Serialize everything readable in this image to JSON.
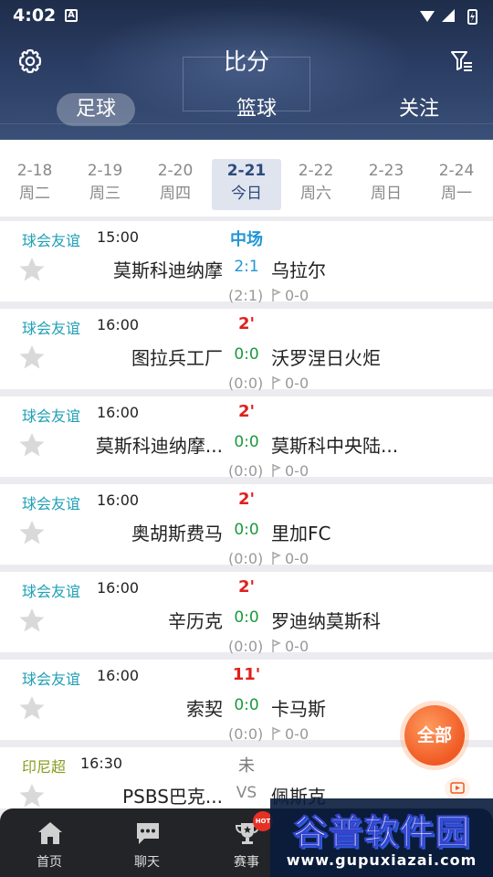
{
  "status_bar": {
    "time": "4:02",
    "notification_letter": "A"
  },
  "header": {
    "title": "比分"
  },
  "tabs": [
    {
      "label": "足球",
      "active": true
    },
    {
      "label": "篮球",
      "active": false
    },
    {
      "label": "关注",
      "active": false
    }
  ],
  "dates": [
    {
      "date": "2-18",
      "weekday": "周二"
    },
    {
      "date": "2-19",
      "weekday": "周三"
    },
    {
      "date": "2-20",
      "weekday": "周四"
    },
    {
      "date": "2-21",
      "weekday": "今日",
      "active": true
    },
    {
      "date": "2-22",
      "weekday": "周六"
    },
    {
      "date": "2-23",
      "weekday": "周日"
    },
    {
      "date": "2-24",
      "weekday": "周一"
    }
  ],
  "matches": [
    {
      "league": "球会友谊",
      "time": "15:00",
      "home": "莫斯科迪纳摩",
      "away": "乌拉尔",
      "status": "中场",
      "score": "2:1",
      "half": "(2:1)",
      "corners": "0-0"
    },
    {
      "league": "球会友谊",
      "time": "16:00",
      "home": "图拉兵工厂",
      "away": "沃罗涅日火炬",
      "status": "2'",
      "score": "0:0",
      "half": "(0:0)",
      "corners": "0-0"
    },
    {
      "league": "球会友谊",
      "time": "16:00",
      "home": "莫斯科迪纳摩...",
      "away": "莫斯科中央陆...",
      "status": "2'",
      "score": "0:0",
      "half": "(0:0)",
      "corners": "0-0"
    },
    {
      "league": "球会友谊",
      "time": "16:00",
      "home": "奥胡斯费马",
      "away": "里加FC",
      "status": "2'",
      "score": "0:0",
      "half": "(0:0)",
      "corners": "0-0"
    },
    {
      "league": "球会友谊",
      "time": "16:00",
      "home": "辛历克",
      "away": "罗迪纳莫斯科",
      "status": "2'",
      "score": "0:0",
      "half": "(0:0)",
      "corners": "0-0"
    },
    {
      "league": "球会友谊",
      "time": "16:00",
      "home": "索契",
      "away": "卡马斯",
      "status": "11'",
      "score": "0:0",
      "half": "(0:0)",
      "corners": "0-0"
    },
    {
      "league": "印尼超",
      "time": "16:30",
      "home": "PSBS巴克...",
      "away": "佩斯克",
      "status": "未",
      "score": "VS"
    }
  ],
  "fab": {
    "label": "全部"
  },
  "bottom_nav": [
    {
      "label": "首页",
      "icon": "home-icon"
    },
    {
      "label": "聊天",
      "icon": "chat-icon"
    },
    {
      "label": "赛事",
      "icon": "trophy-icon"
    }
  ],
  "hot_badge": "HOT",
  "watermark": {
    "logo": "谷普软件园",
    "url": "www.gupuxiazai.com"
  },
  "colors": {
    "league": "#21a0b5",
    "live": "#e0211d",
    "score": "#1a9a3c",
    "halftime": "#2196d6",
    "fab": "#f05a24"
  }
}
